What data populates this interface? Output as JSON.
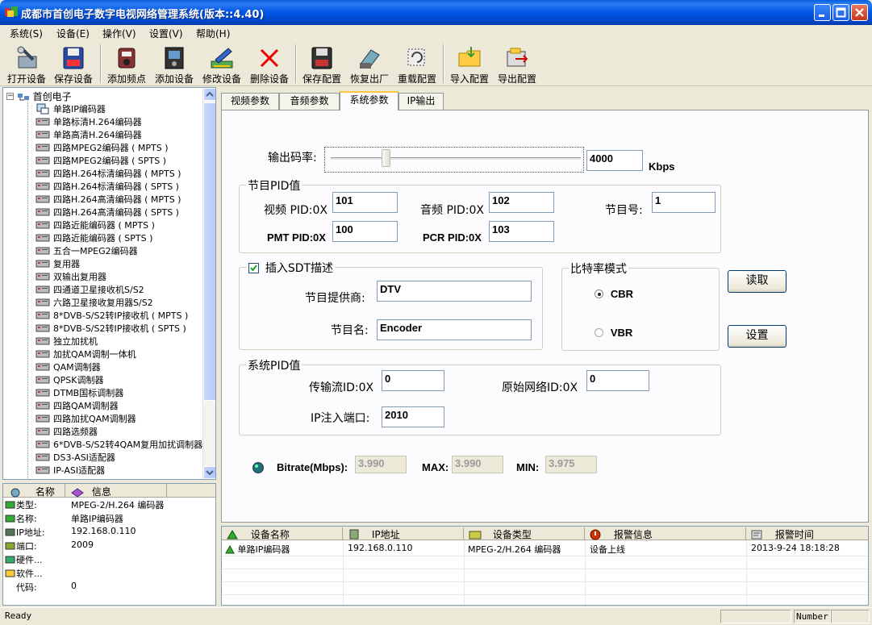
{
  "window": {
    "title": "成都市首创电子数字电视网络管理系统(版本::4.40)"
  },
  "menu": [
    "系统(S)",
    "设备(E)",
    "操作(V)",
    "设置(V)",
    "帮助(H)"
  ],
  "toolbar": {
    "open_device": "打开设备",
    "save_device": "保存设备",
    "add_freq": "添加频点",
    "add_device": "添加设备",
    "edit_device": "修改设备",
    "delete_device": "删除设备",
    "save_config": "保存配置",
    "factory_reset": "恢复出厂",
    "reload_config": "重载配置",
    "import_config": "导入配置",
    "export_config": "导出配置"
  },
  "tree": {
    "root": "首创电子",
    "items": [
      "单路IP编码器",
      "单路标清H.264编码器",
      "单路高清H.264编码器",
      "四路MPEG2编码器 ( MPTS )",
      "四路MPEG2编码器 ( SPTS )",
      "四路H.264标清编码器 ( MPTS )",
      "四路H.264标清编码器 ( SPTS )",
      "四路H.264高清编码器 ( MPTS )",
      "四路H.264高清编码器 ( SPTS )",
      "四路近能编码器 ( MPTS )",
      "四路近能编码器 ( SPTS )",
      "五合一MPEG2编码器",
      "复用器",
      "双输出复用器",
      "四通道卫星接收机S/S2",
      "六路卫星接收复用器S/S2",
      "8*DVB-S/S2转IP接收机 ( MPTS )",
      "8*DVB-S/S2转IP接收机 ( SPTS )",
      "独立加扰机",
      "加扰QAM调制一体机",
      "QAM调制器",
      "QPSK调制器",
      "DTMB国标调制器",
      "四路QAM调制器",
      "四路加扰QAM调制器",
      "四路选频器",
      "6*DVB-S/S2转4QAM复用加扰调制器",
      "DS3-ASI适配器",
      "IP-ASI适配器"
    ]
  },
  "info": {
    "col_name": "名称",
    "col_info": "信息",
    "rows": [
      {
        "k": "类型:",
        "v": "MPEG-2/H.264 编码器"
      },
      {
        "k": "名称:",
        "v": "单路IP编码器"
      },
      {
        "k": "IP地址:",
        "v": "192.168.0.110"
      },
      {
        "k": "端口:",
        "v": "2009"
      },
      {
        "k": "硬件...",
        "v": ""
      },
      {
        "k": "软件...",
        "v": ""
      },
      {
        "k": "代码:",
        "v": "0"
      }
    ]
  },
  "tabs": [
    "视频参数",
    "音频参数",
    "系统参数",
    "IP输出"
  ],
  "active_tab": "系统参数",
  "panel": {
    "bitrate_label": "输出码率:",
    "bitrate_value": "4000",
    "bitrate_unit": "Kbps",
    "bitrate_slider_fraction": 0.22,
    "pid_group": "节目PID值",
    "video_pid_label": "视频 PID:0X",
    "video_pid": "101",
    "audio_pid_label": "音频 PID:0X",
    "audio_pid": "102",
    "program_no_label": "节目号:",
    "program_no": "1",
    "pmt_pid_label": "PMT PID:0X",
    "pmt_pid": "100",
    "pcr_pid_label": "PCR PID:0X",
    "pcr_pid": "103",
    "sdt_group": "插入SDT描述",
    "sdt_checked": true,
    "provider_label": "节目提供商:",
    "provider": "DTV",
    "name_label": "节目名:",
    "name": "Encoder",
    "mode_group": "比特率模式",
    "cbr": "CBR",
    "vbr": "VBR",
    "mode": "CBR",
    "read_button": "读取",
    "set_button": "设置",
    "sys_group": "系统PID值",
    "ts_id_label": "传输流ID:0X",
    "ts_id": "0",
    "onid_label": "原始网络ID:0X",
    "onid": "0",
    "ip_port_label": "IP注入端口:",
    "ip_port": "2010",
    "bitrate_mbps_label": "Bitrate(Mbps):",
    "bitrate_mbps": "3.990",
    "max_label": "MAX:",
    "max": "3.990",
    "min_label": "MIN:",
    "min": "3.975"
  },
  "alarm": {
    "headers": [
      "设备名称",
      "IP地址",
      "设备类型",
      "报警信息",
      "报警时间"
    ],
    "rows": [
      [
        "单路IP编码器",
        "192.168.0.110",
        "MPEG-2/H.264 编码器",
        "设备上线",
        "2013-9-24 18:18:28"
      ]
    ]
  },
  "status": {
    "left": "Ready",
    "right": "Number"
  }
}
